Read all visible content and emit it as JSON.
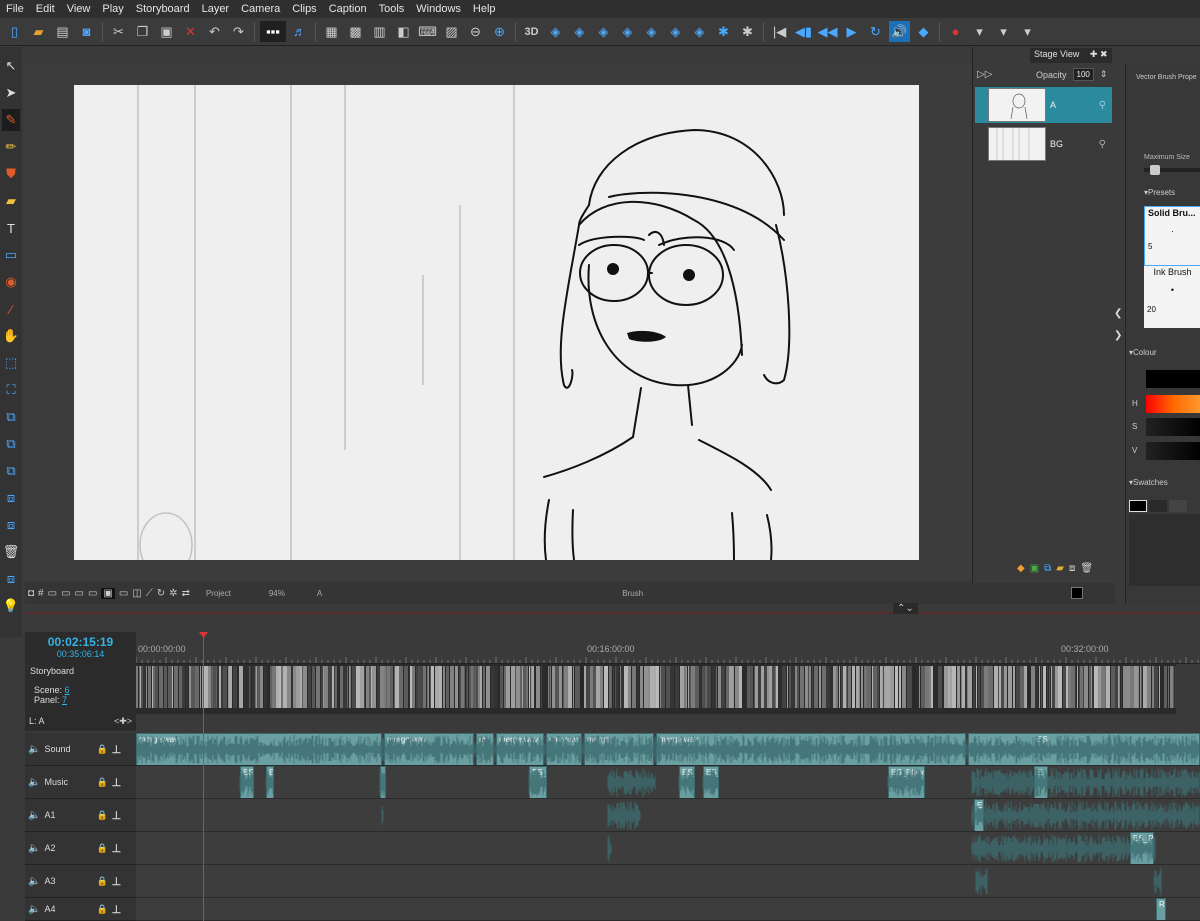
{
  "menu": [
    "File",
    "Edit",
    "View",
    "Play",
    "Storyboard",
    "Layer",
    "Camera",
    "Clips",
    "Caption",
    "Tools",
    "Windows",
    "Help"
  ],
  "stage_view": {
    "tab_label": "Stage View",
    "opacity_label": "Opacity",
    "opacity_value": "100"
  },
  "layers": [
    {
      "name": "A",
      "selected": true
    },
    {
      "name": "BG",
      "selected": false
    }
  ],
  "stage_footer": {
    "camera": "Project",
    "zoom": "94%",
    "layer": "A",
    "tool": "Brush"
  },
  "properties": {
    "title": "Vector Brush Prope",
    "max_size_label": "Maximum Size",
    "presets_label": "Presets",
    "presets": [
      {
        "name": "Solid Bru...",
        "size": "5"
      },
      {
        "name": "Ink Brush",
        "size": "20"
      }
    ],
    "colour_label": "Colour",
    "swatches_label": "Swatches",
    "h_label": "H",
    "s_label": "S",
    "v_label": "V"
  },
  "timeline": {
    "current_time": "00:02:15:19",
    "total_time": "00:35:06:14",
    "ruler": [
      "00:00:00:00",
      "00:16:00:00",
      "00:32:00:00"
    ],
    "storyboard_label": "Storyboard",
    "scene_label": "Scene:",
    "scene_value": "6",
    "panel_label": "Panel:",
    "panel_value": "7",
    "layer_indicator": "L: A",
    "tracks": [
      {
        "name": "Sound",
        "clips": [
          "merge.wav",
          "merge.wav",
          "m",
          "merge.wav",
          "merge.w",
          "merge",
          "merge.wav",
          "ES"
        ]
      },
      {
        "name": "Music",
        "clips": [
          "ES",
          "E",
          "s",
          "ES_C",
          "ES_",
          "ES_",
          "ES_Place",
          "E"
        ]
      },
      {
        "name": "A1",
        "clips": [
          "E"
        ]
      },
      {
        "name": "A2",
        "clips": [
          "ES_P"
        ]
      },
      {
        "name": "A3",
        "clips": []
      },
      {
        "name": "A4",
        "clips": [
          "R"
        ]
      }
    ]
  }
}
